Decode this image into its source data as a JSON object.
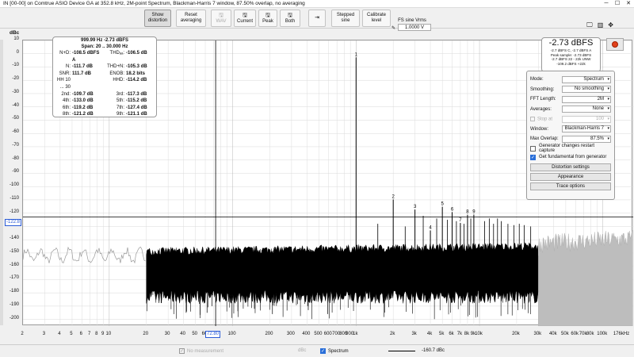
{
  "window": {
    "title": "IN [00-00] on Comtrue ASIO Device GA at 352.8 kHz, 2M-point Spectrum, Blackman-Harris 7 window, 87.50% overlap, no averaging",
    "minimize": "─",
    "maximize": "☐",
    "close": "✕"
  },
  "toolbar": {
    "show_distortion": "Show distortion",
    "reset_averaging": "Reset averaging",
    "wav": "WAV",
    "current": "Current",
    "peak": "Peak",
    "both": "Both",
    "stepped_sine": "Stepped sine",
    "calibrate_level": "Calibrate level",
    "fs_label": "FS sine Vrms",
    "fs_value": "1.0000 V"
  },
  "plot": {
    "y_unit": "dBc",
    "y_cursor": "-122.8",
    "x_cursor": "72.80",
    "y_ticks": [
      "10",
      "0",
      "-10",
      "-20",
      "-30",
      "-40",
      "-50",
      "-60",
      "-70",
      "-80",
      "-90",
      "-100",
      "-110",
      "-120",
      "-130",
      "-140",
      "-150",
      "-160",
      "-170",
      "-180",
      "-190",
      "-200"
    ],
    "x_ticks": [
      "2",
      "3",
      "4",
      "5",
      "6",
      "7",
      "8",
      "9",
      "10",
      "20",
      "30",
      "40",
      "50",
      "60",
      "70",
      "100",
      "200",
      "300",
      "400",
      "500",
      "600",
      "700",
      "800",
      "900",
      "1k",
      "2k",
      "3k",
      "4k",
      "5k",
      "6k",
      "7k",
      "8k",
      "9k",
      "10k",
      "20k",
      "30k",
      "40k",
      "50k",
      "60k",
      "70k",
      "80k",
      "100k",
      "176kHz"
    ],
    "harmonic_labels": [
      "1",
      "2",
      "3",
      "4",
      "5",
      "6",
      "7",
      "8",
      "9"
    ]
  },
  "stats": {
    "header1": "999.99 Hz  -2.73 dBFS",
    "header2": "Span: 20 .. 30.000 Hz",
    "rows": [
      [
        "N+D:",
        "-108.5 dBFS A",
        "THDₐₐ:",
        "-106.5 dB"
      ],
      [
        "N:",
        "-111.7 dB",
        "THD+N:",
        "-105.3 dB"
      ],
      [
        "SNR:",
        "111.7 dB",
        "ENOB:",
        "18.2 bits"
      ],
      [
        "HH 10 ... 30",
        "",
        "HHD:",
        "-114.2 dB"
      ],
      [
        "2nd:",
        "-109.7 dB",
        "3rd:",
        "-117.3 dB"
      ],
      [
        "4th:",
        "-133.0 dB",
        "5th:",
        "-115.2 dB"
      ],
      [
        "6th:",
        "-119.2 dB",
        "7th:",
        "-127.4 dB"
      ],
      [
        "8th:",
        "-121.2 dB",
        "9th:",
        "-121.1 dB"
      ]
    ]
  },
  "level": {
    "value": "-2.73 dBFS",
    "line1": "-2.7 dBFS C, -2.7 dBFS A",
    "line2": "Peak sample: -2.73 dBFS",
    "line3": "-2.7 dBFS 22 - 22k UNW",
    "line4": "-109.2 dBFS +22k"
  },
  "settings": {
    "mode_label": "Mode:",
    "mode_value": "Spectrum",
    "smoothing_label": "Smoothing:",
    "smoothing_value": "No smoothing",
    "fft_label": "FFT Length:",
    "fft_value": "2M",
    "averages_label": "Averages:",
    "averages_value": "None",
    "stop_label": "Stop at",
    "stop_value": "100",
    "window_label": "Window:",
    "window_value": "Blackman-Harris 7",
    "overlap_label": "Max Overlap:",
    "overlap_value": "87.5%",
    "gen_restart": "Generator changes restart capture",
    "get_fundamental": "Get fundamental from generator",
    "distortion_settings": "Distortion settings",
    "appearance": "Appearance",
    "trace_options": "Trace options"
  },
  "legend": {
    "no_measurement": "No measurement",
    "dbc": "dBc",
    "spectrum": "Spectrum",
    "spectrum_value": "-160.7 dBc"
  },
  "colors": {
    "trace": "#000000",
    "trace_hf": "#b0b0b0",
    "cursor": "#2a5bd7",
    "record": "#e0401a"
  }
}
